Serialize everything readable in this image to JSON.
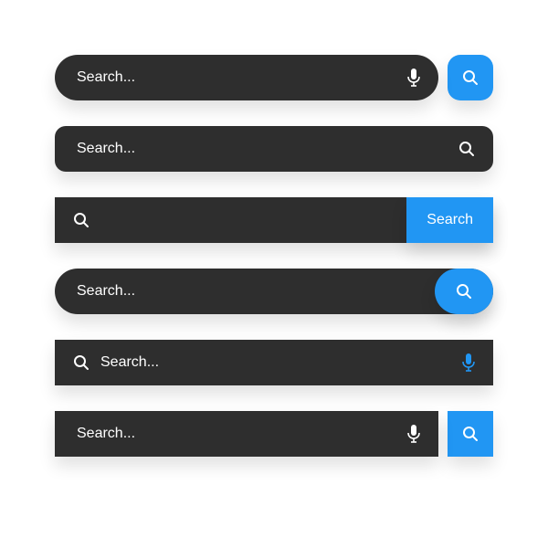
{
  "placeholder": "Search...",
  "button_label": "Search",
  "colors": {
    "bar_bg": "#2e2e2e",
    "accent": "#2196f3",
    "text": "#ffffff"
  },
  "icons": {
    "search": "search-icon",
    "microphone": "microphone-icon"
  }
}
